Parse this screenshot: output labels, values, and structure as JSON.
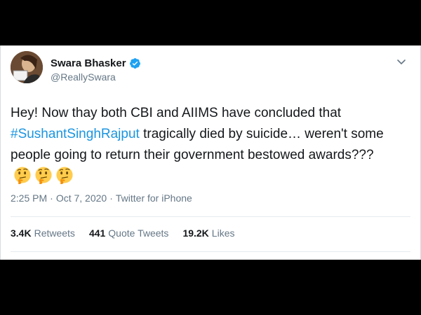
{
  "tweet": {
    "author": {
      "name": "Swara Bhasker",
      "handle": "@ReallySwara"
    },
    "text_part1": "Hey! Now thay both CBI and AIIMS have concluded that",
    "hashtag": "#SushantSinghRajput",
    "text_part2": " tragically died by suicide… weren't some people going to return their government bestowed awards???",
    "emojis": [
      "thinking-face",
      "thinking-face",
      "thinking-face"
    ],
    "time": "2:25 PM",
    "separator1": "·",
    "date": "Oct 7, 2020",
    "separator2": "·",
    "source": "Twitter for iPhone",
    "stats": {
      "retweets_count": "3.4K",
      "retweets_label": "Retweets",
      "quotes_count": "441",
      "quotes_label": "Quote Tweets",
      "likes_count": "19.2K",
      "likes_label": "Likes"
    },
    "colors": {
      "link": "#1b95e0",
      "verified": "#1da1f2",
      "secondary_text": "#657786"
    }
  }
}
